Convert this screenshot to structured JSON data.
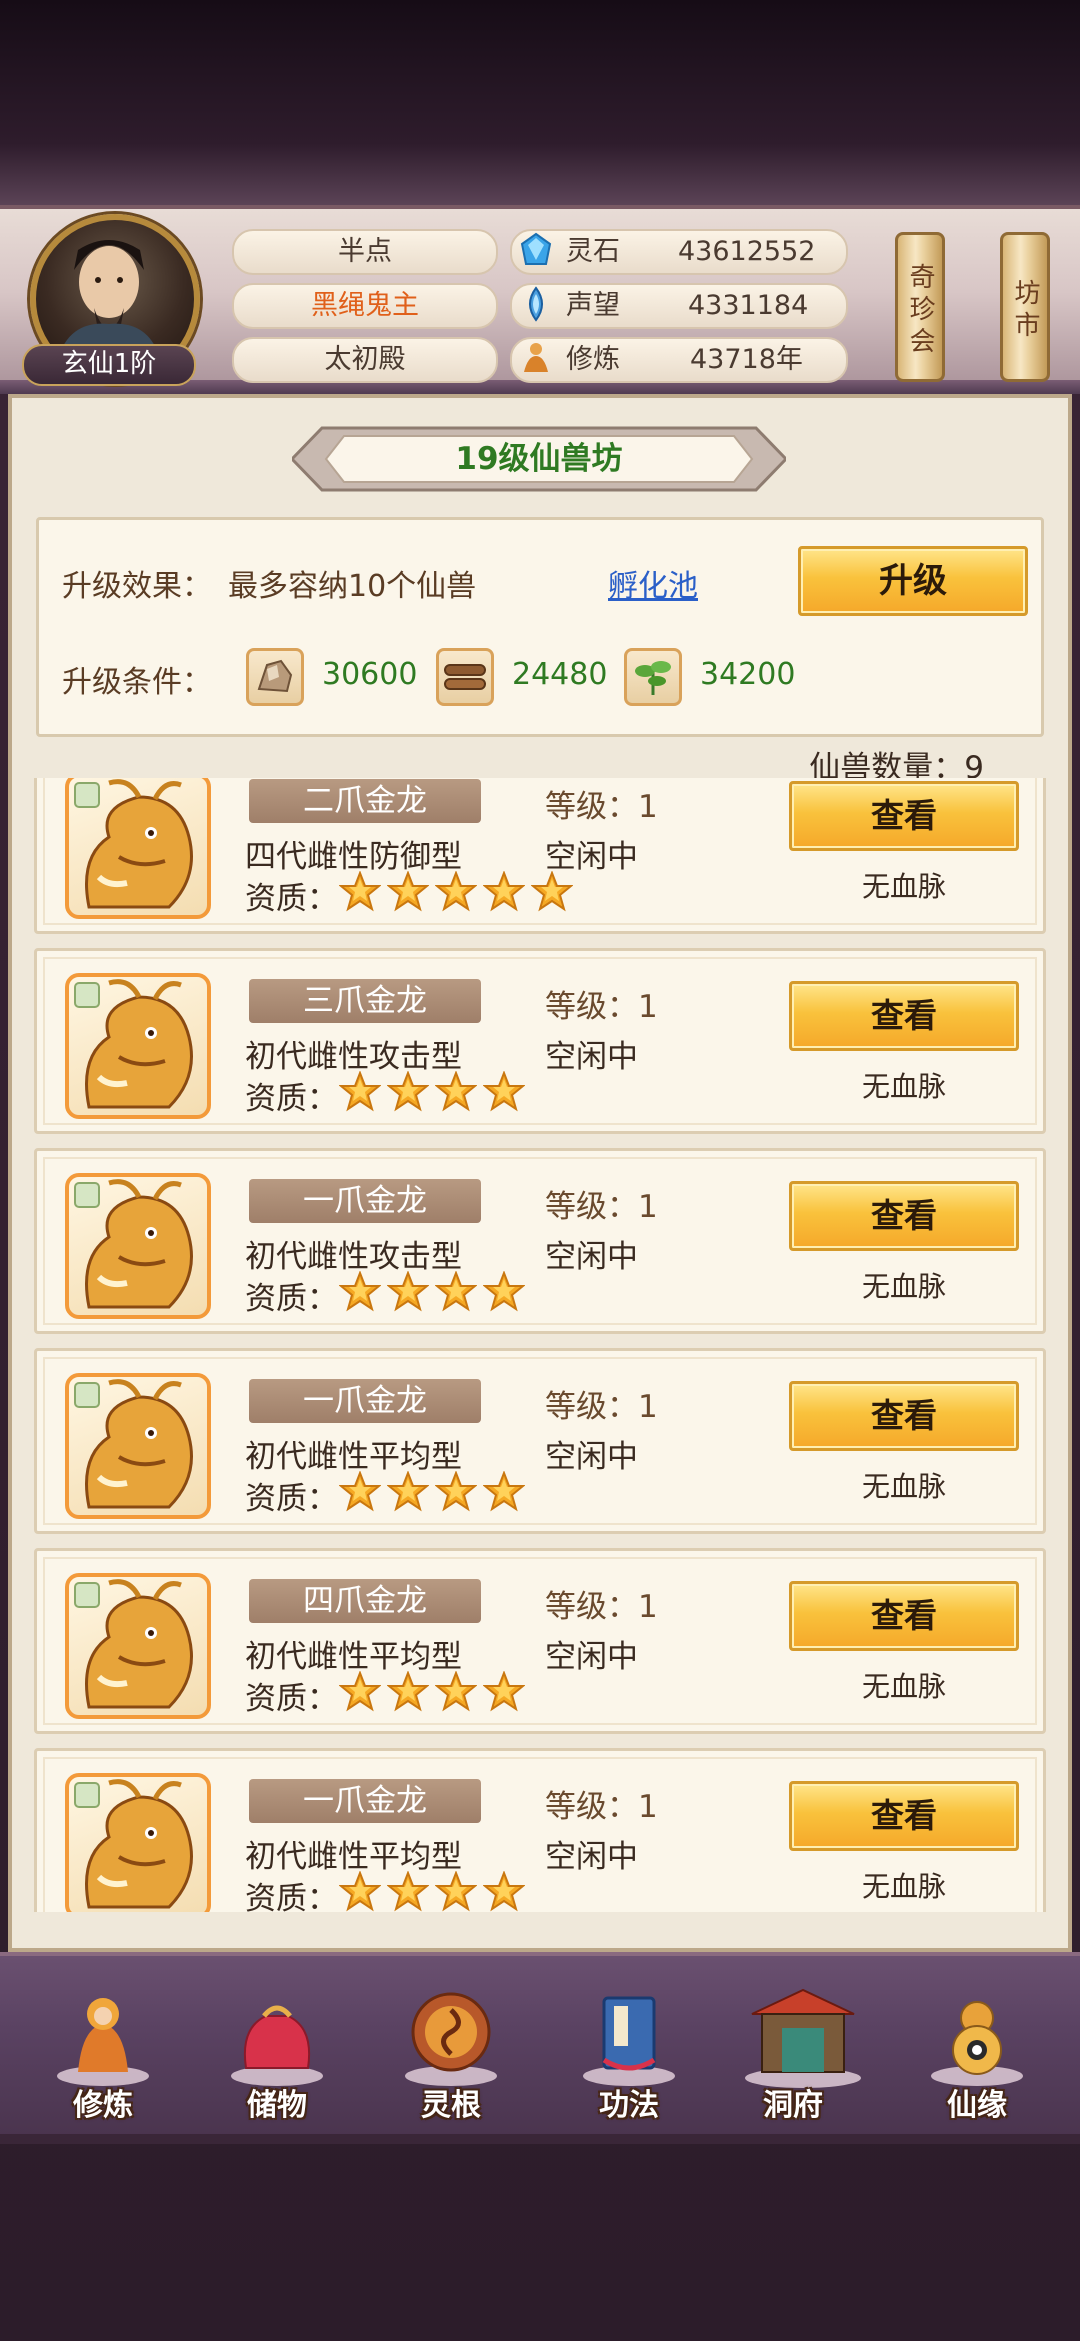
{
  "player": {
    "rank": "玄仙1阶",
    "tags": [
      "半点",
      "黑绳鬼主",
      "太初殿"
    ],
    "highlight_tag_color": "#e0601a"
  },
  "resources": [
    {
      "icon": "spirit-stone-icon",
      "label": "灵石",
      "value": "43612552"
    },
    {
      "icon": "reputation-icon",
      "label": "声望",
      "value": "4331184"
    },
    {
      "icon": "cultivation-icon",
      "label": "修炼",
      "value": "43718年"
    }
  ],
  "side_buttons": [
    "奇珍会",
    "坊市"
  ],
  "panel": {
    "title": "19级仙兽坊",
    "effect_label": "升级效果：",
    "effect_text": "最多容纳10个仙兽",
    "pool_link": "孵化池",
    "upgrade_button": "升级",
    "condition_label": "升级条件：",
    "materials": [
      {
        "icon": "ore-icon",
        "value": "30600"
      },
      {
        "icon": "wood-icon",
        "value": "24480"
      },
      {
        "icon": "herb-icon",
        "value": "34200"
      }
    ],
    "count_label": "仙兽数量：",
    "count_value": "9"
  },
  "beasts": [
    {
      "name": "二爪金龙",
      "type": "四代雌性防御型",
      "level_label": "等级：",
      "level": "1",
      "status": "空闲中",
      "quality_label": "资质：",
      "stars": 5,
      "button": "查看",
      "bloodline": "无血脉"
    },
    {
      "name": "三爪金龙",
      "type": "初代雌性攻击型",
      "level_label": "等级：",
      "level": "1",
      "status": "空闲中",
      "quality_label": "资质：",
      "stars": 4,
      "button": "查看",
      "bloodline": "无血脉"
    },
    {
      "name": "一爪金龙",
      "type": "初代雌性攻击型",
      "level_label": "等级：",
      "level": "1",
      "status": "空闲中",
      "quality_label": "资质：",
      "stars": 4,
      "button": "查看",
      "bloodline": "无血脉"
    },
    {
      "name": "一爪金龙",
      "type": "初代雌性平均型",
      "level_label": "等级：",
      "level": "1",
      "status": "空闲中",
      "quality_label": "资质：",
      "stars": 4,
      "button": "查看",
      "bloodline": "无血脉"
    },
    {
      "name": "四爪金龙",
      "type": "初代雌性平均型",
      "level_label": "等级：",
      "level": "1",
      "status": "空闲中",
      "quality_label": "资质：",
      "stars": 4,
      "button": "查看",
      "bloodline": "无血脉"
    },
    {
      "name": "一爪金龙",
      "type": "初代雌性平均型",
      "level_label": "等级：",
      "level": "1",
      "status": "空闲中",
      "quality_label": "资质：",
      "stars": 4,
      "button": "查看",
      "bloodline": "无血脉"
    }
  ],
  "nav": [
    {
      "icon": "cultivate-icon",
      "label": "修炼"
    },
    {
      "icon": "storage-bag-icon",
      "label": "储物"
    },
    {
      "icon": "spirit-root-icon",
      "label": "灵根"
    },
    {
      "icon": "technique-book-icon",
      "label": "功法"
    },
    {
      "icon": "cave-mansion-icon",
      "label": "洞府"
    },
    {
      "icon": "fortune-gourd-icon",
      "label": "仙缘"
    }
  ]
}
